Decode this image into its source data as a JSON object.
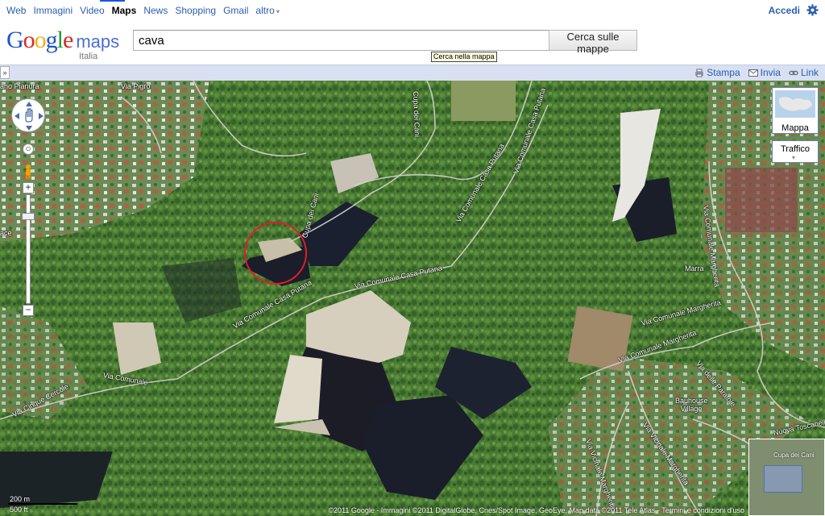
{
  "topnav": {
    "items": [
      {
        "label": "Web"
      },
      {
        "label": "Immagini"
      },
      {
        "label": "Video"
      },
      {
        "label": "Maps"
      },
      {
        "label": "News"
      },
      {
        "label": "Shopping"
      },
      {
        "label": "Gmail"
      },
      {
        "label": "altro"
      }
    ],
    "active": "Maps",
    "signin": "Accedi"
  },
  "logo": {
    "google": "Google",
    "maps": "maps",
    "country": "Italia"
  },
  "search": {
    "value": "cava",
    "button": "Cerca sulle mappe",
    "tooltip": "Cerca nella mappa"
  },
  "toolbar": {
    "collapse": "»",
    "print": "Stampa",
    "send": "Invia",
    "link": "Link"
  },
  "map_type": {
    "label": "Mappa",
    "traffic": "Traffico"
  },
  "roads": [
    "Via Pigro",
    "Cupa dei Cani",
    "Cupa dei Cani",
    "Via Comunale Casa Putana",
    "Via Comunale Casa Putana",
    "Via Comunale Casa Putana",
    "Via Comunale Casa Putana",
    "Via Cinque Cercole",
    "Via Comunale",
    "Via Comunale Margherita",
    "Via Comunale Margherita",
    "Via delle Paratoie",
    "Via Vicinale Margherita",
    "Via Vicinale Margherita",
    "Via Comunale Margherita",
    "Nuova Toscanella",
    "Marra",
    "Bauhouse Village",
    "ano Pianura",
    "ace"
  ],
  "overview": {
    "label": "Cupa dei Cani"
  },
  "scale": {
    "metric": "200 m",
    "imperial": "500 ft"
  },
  "copyright": "©2011 Google - Immagini ©2011 DigitalGlobe, Cnes/Spot Image, GeoEye, Map data ©2011 Tele Atlas - Termini e condizioni d'uso",
  "colors": {
    "link": "#2a5db0",
    "toolbar_bg": "#d8e0f1",
    "highlight_circle": "#e0202a"
  }
}
